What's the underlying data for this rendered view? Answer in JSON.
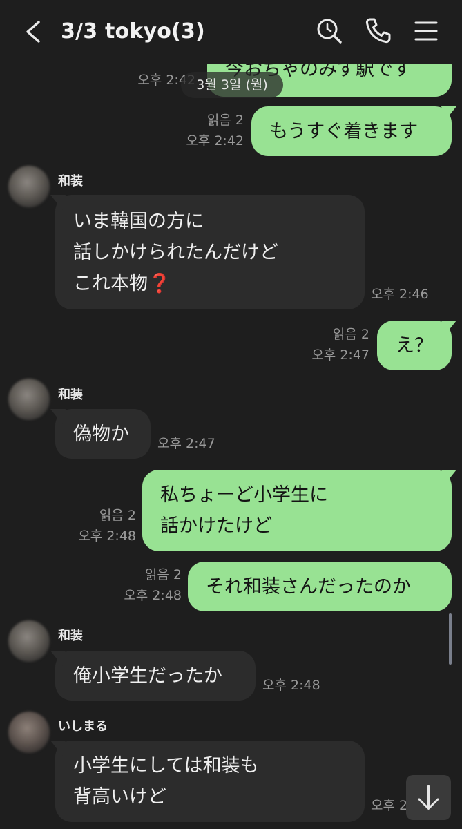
{
  "header": {
    "title": "3/3 tokyo(3)",
    "icons": [
      "back-chevron-icon",
      "search-icon",
      "phone-icon",
      "menu-icon"
    ]
  },
  "date_divider": "3월 3일 (월)",
  "messages": [
    {
      "type": "out",
      "text": "今おちゃのみず駅です",
      "read": "",
      "time": "오후 2:42"
    },
    {
      "type": "out",
      "text": "もうすぐ着きます",
      "read": "읽음 2",
      "time": "오후 2:42"
    },
    {
      "type": "in",
      "sender": "和装",
      "lines": [
        "いま韓国の方に",
        "話しかけられたんだけど",
        "これ本物"
      ],
      "emoji": "❓",
      "time": "오후 2:46"
    },
    {
      "type": "out",
      "text": "え？",
      "read": "읽음 2",
      "time": "오후 2:47"
    },
    {
      "type": "in",
      "sender": "和装",
      "lines": [
        "偽物か"
      ],
      "time": "오후 2:47"
    },
    {
      "type": "out",
      "lines": [
        "私ちょーど小学生に",
        "話かけたけど"
      ],
      "read": "읽음 2",
      "time": "오후 2:48"
    },
    {
      "type": "out",
      "text": "それ和装さんだったのか",
      "read": "읽음 2",
      "time": "오후 2:48"
    },
    {
      "type": "in",
      "sender": "和装",
      "lines": [
        "俺小学生だったか"
      ],
      "time": "오후 2:48"
    },
    {
      "type": "in",
      "sender": "いしまる",
      "lines": [
        "小学生にしては和装も",
        "背高いけど"
      ],
      "time": "오후 2:"
    }
  ],
  "colors": {
    "background": "#1e1e1e",
    "outgoing_bubble": "#98e293",
    "incoming_bubble": "#2c2c2c",
    "meta_text": "#9a9a9a"
  },
  "controls": {
    "scroll_down_icon": "arrow-down-icon"
  }
}
